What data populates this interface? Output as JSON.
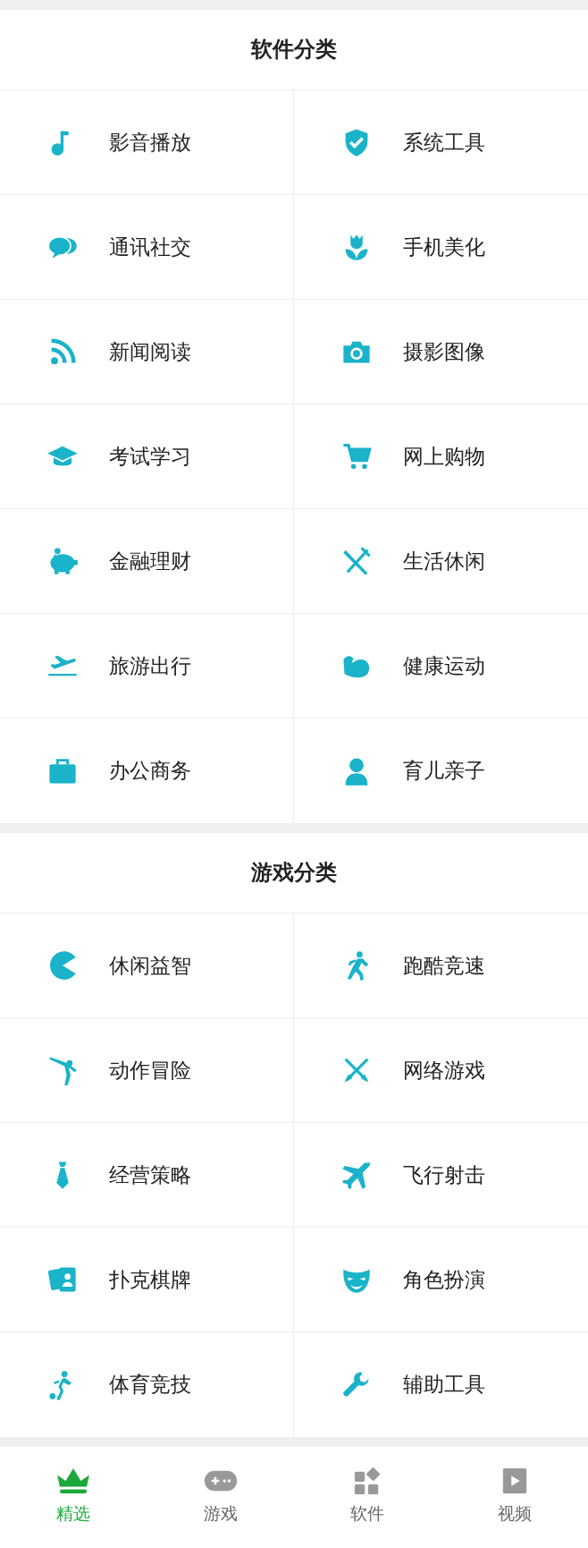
{
  "sections": [
    {
      "title": "软件分类",
      "items": [
        "影音播放",
        "系统工具",
        "通讯社交",
        "手机美化",
        "新闻阅读",
        "摄影图像",
        "考试学习",
        "网上购物",
        "金融理财",
        "生活休闲",
        "旅游出行",
        "健康运动",
        "办公商务",
        "育儿亲子"
      ]
    },
    {
      "title": "游戏分类",
      "items": [
        "休闲益智",
        "跑酷竞速",
        "动作冒险",
        "网络游戏",
        "经营策略",
        "飞行射击",
        "扑克棋牌",
        "角色扮演",
        "体育竞技",
        "辅助工具"
      ]
    }
  ],
  "tab_bar": [
    {
      "label": "精选",
      "selected": true
    },
    {
      "label": "游戏",
      "selected": false
    },
    {
      "label": "软件",
      "selected": false
    },
    {
      "label": "视频",
      "selected": false
    }
  ]
}
